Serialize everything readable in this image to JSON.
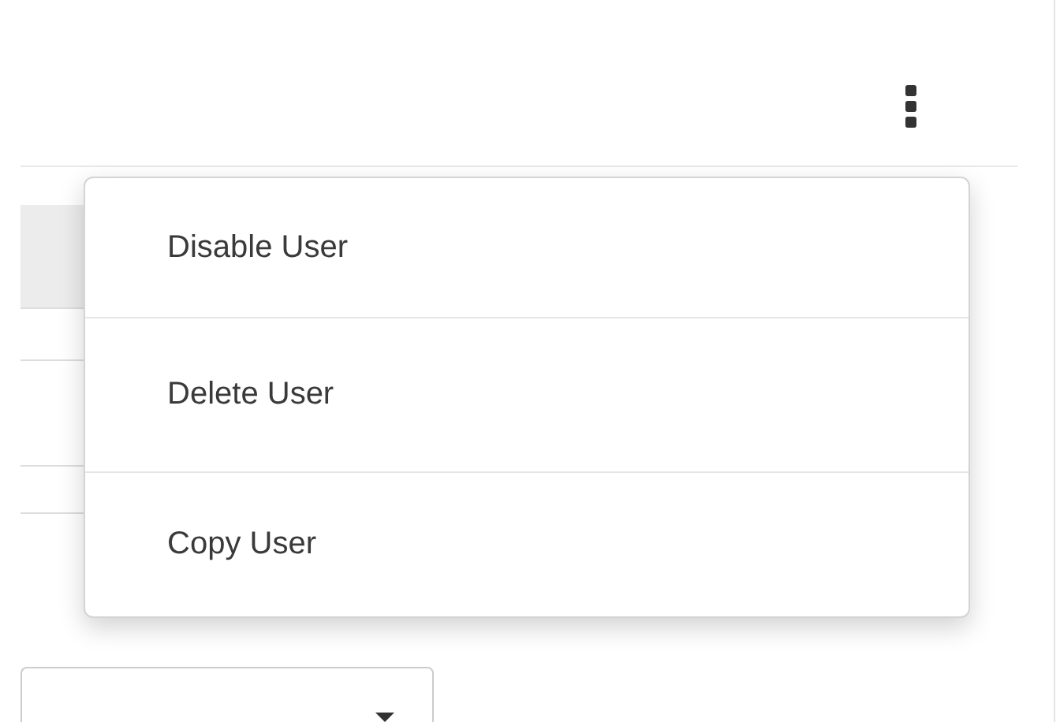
{
  "menu": {
    "items": [
      {
        "label": "Disable User"
      },
      {
        "label": "Delete User"
      },
      {
        "label": "Copy User"
      }
    ]
  }
}
